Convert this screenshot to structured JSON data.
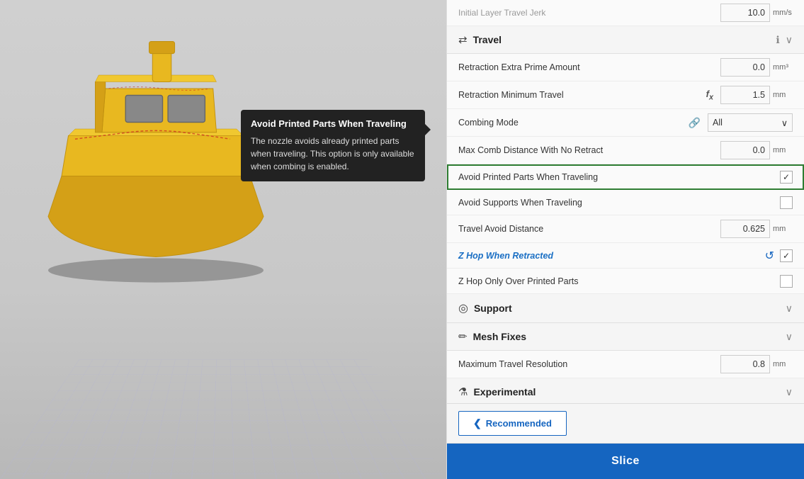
{
  "viewport": {
    "background": "#cccccc"
  },
  "tooltip": {
    "title": "Avoid Printed Parts When Traveling",
    "body": "The nozzle avoids already printed parts when traveling. This option is only available when combing is enabled."
  },
  "panel": {
    "top_row": {
      "label": "Initial Layer Travel Jerk",
      "value": "10.0",
      "unit": "mm/s"
    },
    "travel_section": {
      "title": "Travel",
      "collapsed": false
    },
    "settings": [
      {
        "label": "Retraction Extra Prime Amount",
        "value": "0.0",
        "unit": "mm³",
        "type": "input",
        "has_icon": false
      },
      {
        "label": "Retraction Minimum Travel",
        "value": "1.5",
        "unit": "mm",
        "type": "input",
        "has_icon": true,
        "icon": "fx"
      },
      {
        "label": "Combing Mode",
        "value": "All",
        "unit": "",
        "type": "select",
        "has_icon": true,
        "icon": "link"
      },
      {
        "label": "Max Comb Distance With No Retract",
        "value": "0.0",
        "unit": "mm",
        "type": "input",
        "has_icon": false
      },
      {
        "label": "Avoid Printed Parts When Traveling",
        "value": "checked",
        "unit": "",
        "type": "checkbox-highlighted",
        "has_icon": false
      },
      {
        "label": "Avoid Supports When Traveling",
        "value": "unchecked",
        "unit": "",
        "type": "checkbox",
        "has_icon": false
      },
      {
        "label": "Travel Avoid Distance",
        "value": "0.625",
        "unit": "mm",
        "type": "input",
        "has_icon": false
      },
      {
        "label": "Z Hop When Retracted",
        "value": "checked",
        "unit": "",
        "type": "checkbox-undo",
        "has_icon": false,
        "italic": true
      },
      {
        "label": "Z Hop Only Over Printed Parts",
        "value": "unchecked",
        "unit": "",
        "type": "checkbox",
        "has_icon": false
      }
    ],
    "support_section": {
      "title": "Support",
      "icon": "⊕"
    },
    "mesh_fixes_section": {
      "title": "Mesh Fixes",
      "icon": "✏"
    },
    "mesh_fixes_setting": {
      "label": "Maximum Travel Resolution",
      "value": "0.8",
      "unit": "mm"
    },
    "experimental_section": {
      "title": "Experimental",
      "icon": "⚗"
    },
    "recommended_btn": "Recommended",
    "slice_btn": "Slice"
  }
}
